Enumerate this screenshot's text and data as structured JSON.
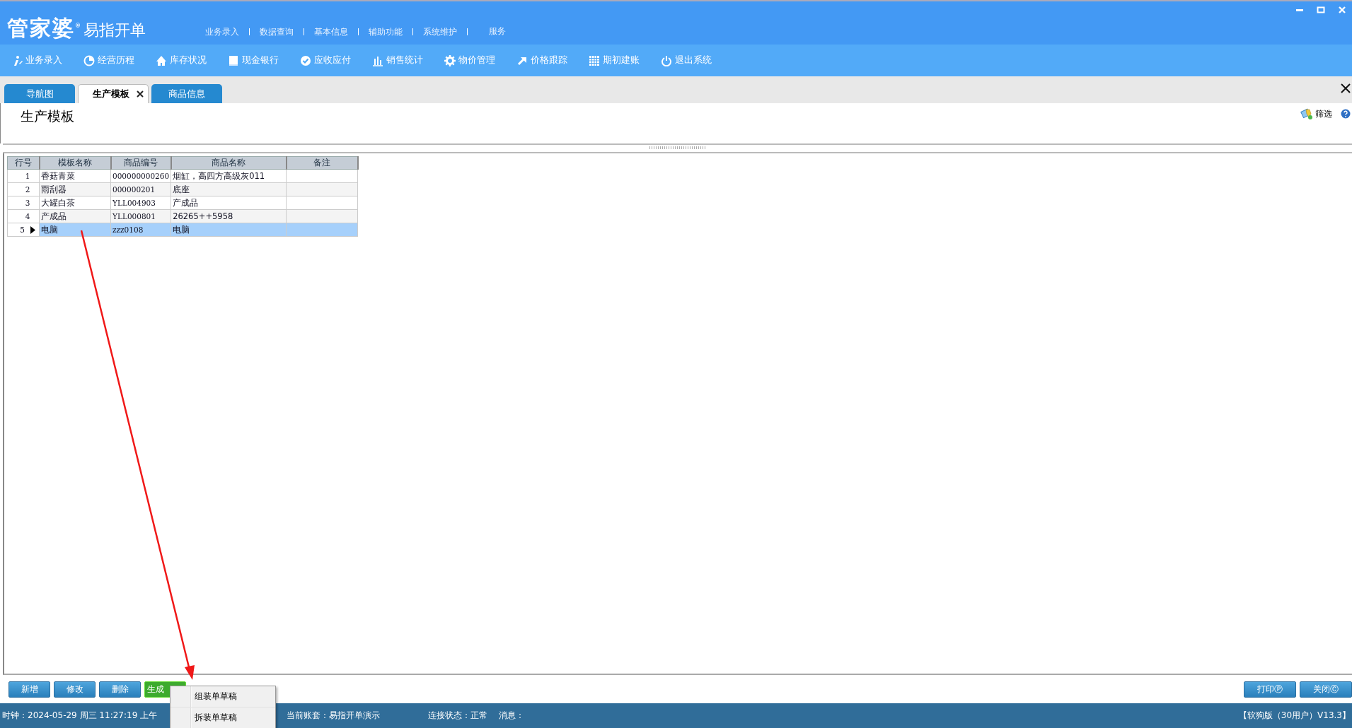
{
  "window": {
    "logo": "管家婆$^{®}$",
    "product": "易指开单"
  },
  "menu": [
    "业务录入",
    "数据查询",
    "基本信息",
    "辅助功能",
    "系统维护",
    "服务"
  ],
  "toolbar": [
    {
      "label": "业务录入",
      "kind": "info"
    },
    {
      "label": "经营历程",
      "kind": "pie"
    },
    {
      "label": "库存状况",
      "kind": "house"
    },
    {
      "label": "现金银行",
      "kind": "book"
    },
    {
      "label": "应收应付",
      "kind": "check"
    },
    {
      "label": "销售统计",
      "kind": "bars"
    },
    {
      "label": "物价管理",
      "kind": "gear"
    },
    {
      "label": "价格跟踪",
      "kind": "arrow"
    },
    {
      "label": "期初建账",
      "kind": "grid"
    },
    {
      "label": "退出系统",
      "kind": "power"
    }
  ],
  "tabs": [
    {
      "label": "导航图",
      "selected": false,
      "closable": false
    },
    {
      "label": "生产模板",
      "selected": true,
      "closable": true
    },
    {
      "label": "商品信息",
      "selected": false,
      "closable": false
    }
  ],
  "page": {
    "title": "生产模板",
    "filter": "筛选"
  },
  "table": {
    "columns": [
      "行号",
      "模板名称",
      "商品编号",
      "商品名称",
      "备注"
    ],
    "rows": [
      {
        "cells": [
          "1",
          "香菇青菜",
          "000000000260",
          "烟缸，高四方高级灰011",
          ""
        ],
        "selected": false
      },
      {
        "cells": [
          "2",
          "雨刮器",
          "000000201",
          "底座",
          ""
        ],
        "selected": false
      },
      {
        "cells": [
          "3",
          "大罐白茶",
          "YLL004903",
          "产成品",
          ""
        ],
        "selected": false
      },
      {
        "cells": [
          "4",
          "产成品",
          "YLL000801",
          "26265++5958",
          ""
        ],
        "selected": false
      },
      {
        "cells": [
          "5",
          "电脑",
          "zzz0108",
          "电脑",
          ""
        ],
        "selected": true
      }
    ]
  },
  "buttons_left": [
    {
      "label": "新增",
      "kind": "normal"
    },
    {
      "label": "修改",
      "kind": "normal"
    },
    {
      "label": "删除",
      "kind": "normal"
    },
    {
      "label": "生成",
      "kind": "highlight"
    }
  ],
  "context_menu": {
    "items": [
      "组装单草稿",
      "拆装单草稿"
    ]
  },
  "buttons_right": [
    {
      "label": "打印Ⓟ",
      "kind": "normal"
    },
    {
      "label": "关闭Ⓒ",
      "kind": "normal"
    }
  ],
  "status_bar": {
    "clock": "时钟：2024-05-29 周三 11:27:19 上午",
    "account": "当前账套：易指开单演示",
    "connection": "连接状态：正常",
    "message": "消息：",
    "version": "【软狗版（30用户）V13.3】"
  }
}
